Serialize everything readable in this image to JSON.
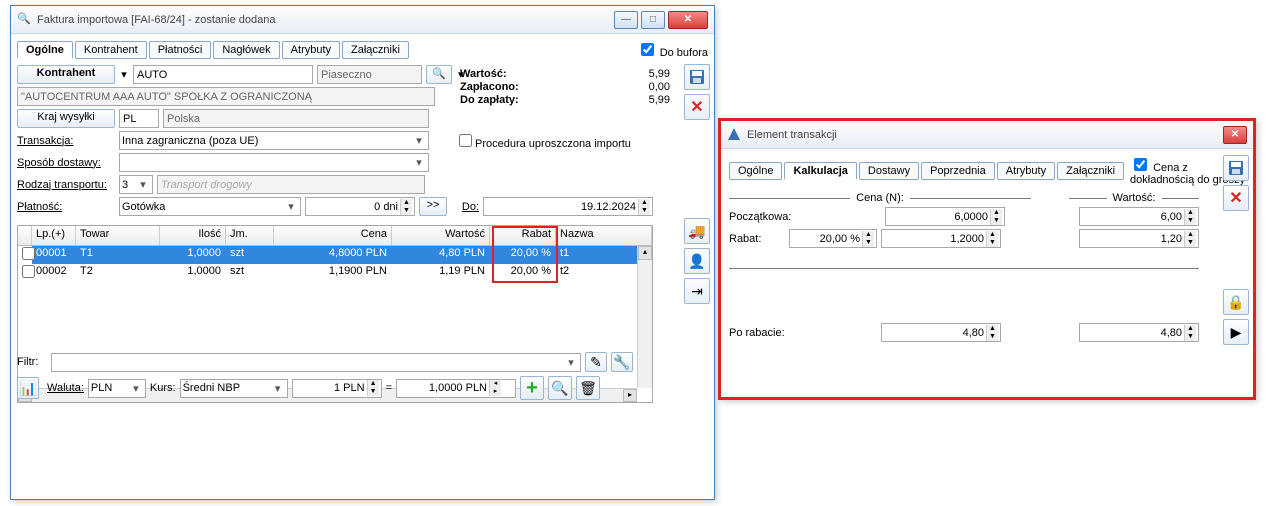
{
  "main": {
    "title": "Faktura importowa [FAI-68/24]  - zostanie dodana",
    "tabs": [
      "Ogólne",
      "Kontrahent",
      "Płatności",
      "Nagłówek",
      "Atrybuty",
      "Załączniki"
    ],
    "active_tab": 0,
    "do_bufora": "Do bufora",
    "kontrahent_btn": "Kontrahent",
    "kontrahent_code": "AUTO",
    "kontrahent_city": "Piaseczno",
    "kontrahent_full": "\"AUTOCENTRUM AAA AUTO\" SPÓŁKA Z OGRANICZONĄ",
    "kraj_wysylki_btn": "Kraj wysyłki",
    "kraj_code": "PL",
    "kraj_name": "Polska",
    "transakcja_lbl": "Transakcja:",
    "transakcja_val": "Inna zagraniczna (poza UE)",
    "sposob_lbl": "Sposób dostawy:",
    "sposob_val": "",
    "rodzaj_lbl": "Rodzaj transportu:",
    "rodzaj_val": "3",
    "rodzaj_placeholder": "Transport drogowy",
    "platnosc_lbl": "Płatność:",
    "platnosc_val": "Gotówka",
    "dni_val": "0 dni",
    "arrows_btn": ">>",
    "do_lbl": "Do:",
    "do_val": "19.12.2024",
    "procedura_lbl": "Procedura uproszczona importu",
    "summary": {
      "wartosc_lbl": "Wartość:",
      "wartosc_val": "5,99",
      "zaplacono_lbl": "Zapłacono:",
      "zaplacono_val": "0,00",
      "do_zaplaty_lbl": "Do zapłaty:",
      "do_zaplaty_val": "5,99"
    },
    "grid": {
      "headers": [
        "Lp.(+)",
        "Towar",
        "Ilość",
        "Jm.",
        "Cena",
        "Wartość",
        "Rabat",
        "Nazwa"
      ],
      "rows": [
        {
          "lp": "00001",
          "towar": "T1",
          "ilosc": "1,0000",
          "jm": "szt",
          "cena": "4,8000 PLN",
          "wartosc": "4,80 PLN",
          "rabat": "20,00 %",
          "nazwa": "t1"
        },
        {
          "lp": "00002",
          "towar": "T2",
          "ilosc": "1,0000",
          "jm": "szt",
          "cena": "1,1900 PLN",
          "wartosc": "1,19 PLN",
          "rabat": "20,00 %",
          "nazwa": "t2"
        }
      ]
    },
    "filtr_lbl": "Filtr:",
    "waluta_lbl": "Waluta:",
    "waluta_val": "PLN",
    "kurs_lbl": "Kurs:",
    "kurs_val": "Średni NBP",
    "kurs_a": "1 PLN",
    "kurs_b": "1,0000 PLN"
  },
  "dlg": {
    "title": "Element transakcji",
    "tabs": [
      "Ogólne",
      "Kalkulacja",
      "Dostawy",
      "Poprzednia",
      "Atrybuty",
      "Załączniki"
    ],
    "active_tab": 1,
    "precision_chk": "Cena z dokładnością do groszy",
    "cena_hdr": "Cena (N):",
    "wartosc_hdr": "Wartość:",
    "pocz_lbl": "Początkowa:",
    "pocz_cena": "6,0000",
    "pocz_wart": "6,00",
    "rabat_lbl": "Rabat:",
    "rabat_pct": "20,00 %",
    "rabat_cena": "1,2000",
    "rabat_wart": "1,20",
    "po_rabacie_lbl": "Po rabacie:",
    "po_rabacie_cena": "4,80",
    "po_rabacie_wart": "4,80"
  }
}
